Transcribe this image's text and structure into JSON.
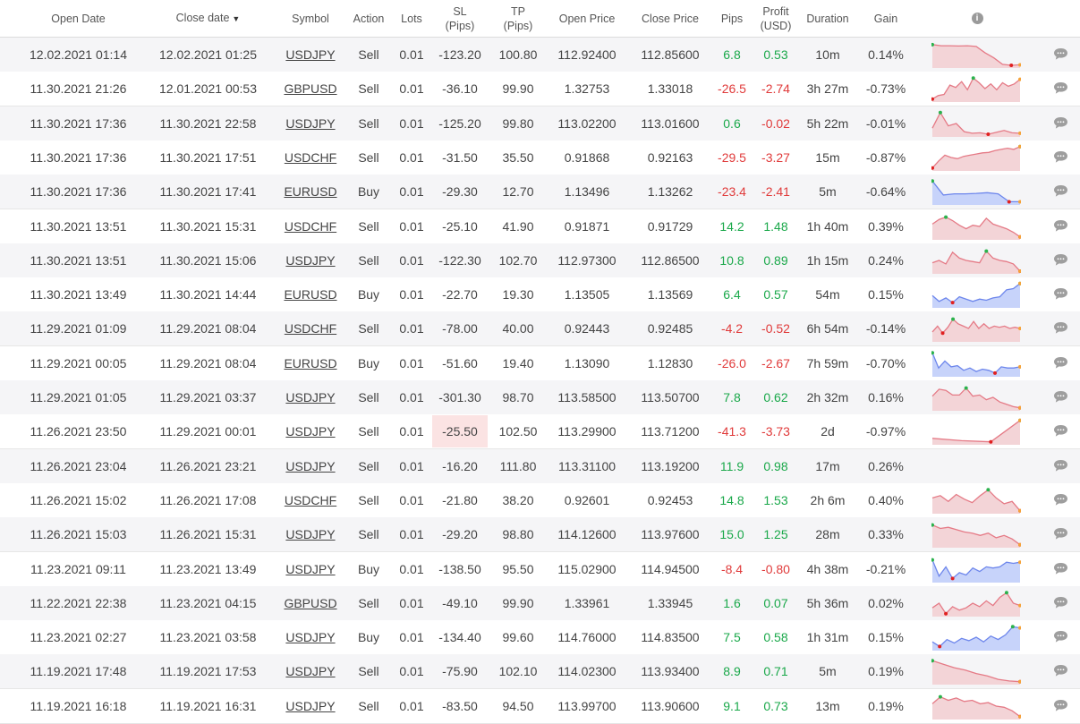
{
  "headers": {
    "open_date": "Open Date",
    "close_date": "Close date",
    "close_date_sort": "▼",
    "symbol": "Symbol",
    "action": "Action",
    "lots": "Lots",
    "sl_1": "SL",
    "sl_2": "(Pips)",
    "tp_1": "TP",
    "tp_2": "(Pips)",
    "open_price": "Open Price",
    "close_price": "Close Price",
    "pips": "Pips",
    "profit_1": "Profit",
    "profit_2": "(USD)",
    "duration": "Duration",
    "gain": "Gain",
    "info_glyph": "i"
  },
  "colors": {
    "positive": "#1aa84a",
    "negative": "#e03a3a",
    "sell_fill": "#f3d4d7",
    "sell_line": "#e57a86",
    "buy_fill": "#c7d3fa",
    "buy_line": "#6d86ec",
    "sl_highlight": "#fbe3e3",
    "comment_icon": "#9e9e9e"
  },
  "rows": [
    {
      "open": "12.02.2021 01:14",
      "close": "12.02.2021 01:25",
      "symbol": "USDJPY",
      "action": "Sell",
      "lots": "0.01",
      "sl": "-123.20",
      "tp": "100.80",
      "open_price": "112.92400",
      "close_price": "112.85600",
      "pips": "6.8",
      "profit": "0.53",
      "duration": "10m",
      "gain": "0.14%",
      "spark": [
        0.93,
        0.88,
        0.88,
        0.87,
        0.88,
        0.85,
        0.58,
        0.36,
        0.08,
        0.04,
        0.06
      ]
    },
    {
      "open": "11.30.2021 21:26",
      "close": "12.01.2021 00:53",
      "symbol": "GBPUSD",
      "action": "Sell",
      "lots": "0.01",
      "sl": "-36.10",
      "tp": "99.90",
      "open_price": "1.32753",
      "close_price": "1.33018",
      "pips": "-26.5",
      "profit": "-2.74",
      "duration": "3h 27m",
      "gain": "-0.73%",
      "spark": [
        0.05,
        0.2,
        0.25,
        0.65,
        0.55,
        0.8,
        0.45,
        0.95,
        0.75,
        0.5,
        0.7,
        0.45,
        0.75,
        0.6,
        0.7,
        0.9
      ]
    },
    {
      "open": "11.30.2021 17:36",
      "close": "11.30.2021 22:58",
      "symbol": "USDJPY",
      "action": "Sell",
      "lots": "0.01",
      "sl": "-125.20",
      "tp": "99.80",
      "open_price": "113.02200",
      "close_price": "113.01600",
      "pips": "0.6",
      "profit": "-0.02",
      "duration": "5h 22m",
      "gain": "-0.01%",
      "spark": [
        0.3,
        0.97,
        0.4,
        0.5,
        0.15,
        0.08,
        0.1,
        0.04,
        0.12,
        0.2,
        0.1,
        0.08
      ]
    },
    {
      "open": "11.30.2021 17:36",
      "close": "11.30.2021 17:51",
      "symbol": "USDCHF",
      "action": "Sell",
      "lots": "0.01",
      "sl": "-31.50",
      "tp": "35.50",
      "open_price": "0.91868",
      "close_price": "0.92163",
      "pips": "-29.5",
      "profit": "-3.27",
      "duration": "15m",
      "gain": "-0.87%",
      "spark": [
        0.05,
        0.35,
        0.6,
        0.5,
        0.45,
        0.55,
        0.6,
        0.65,
        0.7,
        0.72,
        0.8,
        0.85,
        0.9,
        0.85,
        0.97
      ]
    },
    {
      "open": "11.30.2021 17:36",
      "close": "11.30.2021 17:41",
      "symbol": "EURUSD",
      "action": "Buy",
      "lots": "0.01",
      "sl": "-29.30",
      "tp": "12.70",
      "open_price": "1.13496",
      "close_price": "1.13262",
      "pips": "-23.4",
      "profit": "-2.41",
      "duration": "5m",
      "gain": "-0.64%",
      "spark": [
        0.95,
        0.35,
        0.4,
        0.4,
        0.42,
        0.45,
        0.4,
        0.06,
        0.06
      ]
    },
    {
      "open": "11.30.2021 13:51",
      "close": "11.30.2021 15:31",
      "symbol": "USDCHF",
      "action": "Sell",
      "lots": "0.01",
      "sl": "-25.10",
      "tp": "41.90",
      "open_price": "0.91871",
      "close_price": "0.91729",
      "pips": "14.2",
      "profit": "1.48",
      "duration": "1h 40m",
      "gain": "0.39%",
      "spark": [
        0.6,
        0.8,
        0.9,
        0.75,
        0.55,
        0.4,
        0.55,
        0.5,
        0.85,
        0.6,
        0.5,
        0.4,
        0.25,
        0.05
      ]
    },
    {
      "open": "11.30.2021 13:51",
      "close": "11.30.2021 15:06",
      "symbol": "USDJPY",
      "action": "Sell",
      "lots": "0.01",
      "sl": "-122.30",
      "tp": "102.70",
      "open_price": "112.97300",
      "close_price": "112.86500",
      "pips": "10.8",
      "profit": "0.89",
      "duration": "1h 15m",
      "gain": "0.24%",
      "spark": [
        0.4,
        0.5,
        0.35,
        0.85,
        0.6,
        0.5,
        0.45,
        0.4,
        0.9,
        0.6,
        0.5,
        0.45,
        0.35,
        0.04
      ]
    },
    {
      "open": "11.30.2021 13:49",
      "close": "11.30.2021 14:44",
      "symbol": "EURUSD",
      "action": "Buy",
      "lots": "0.01",
      "sl": "-22.70",
      "tp": "19.30",
      "open_price": "1.13505",
      "close_price": "1.13569",
      "pips": "6.4",
      "profit": "0.57",
      "duration": "54m",
      "gain": "0.15%",
      "spark": [
        0.45,
        0.2,
        0.35,
        0.15,
        0.4,
        0.3,
        0.2,
        0.3,
        0.25,
        0.35,
        0.4,
        0.7,
        0.75,
        0.97
      ]
    },
    {
      "open": "11.29.2021 01:09",
      "close": "11.29.2021 08:04",
      "symbol": "USDCHF",
      "action": "Sell",
      "lots": "0.01",
      "sl": "-78.00",
      "tp": "40.00",
      "open_price": "0.92443",
      "close_price": "0.92485",
      "pips": "-4.2",
      "profit": "-0.52",
      "duration": "6h 54m",
      "gain": "-0.14%",
      "spark": [
        0.35,
        0.6,
        0.3,
        0.55,
        0.9,
        0.7,
        0.6,
        0.5,
        0.8,
        0.5,
        0.7,
        0.5,
        0.6,
        0.55,
        0.6,
        0.5,
        0.55,
        0.5
      ]
    },
    {
      "open": "11.29.2021 00:05",
      "close": "11.29.2021 08:04",
      "symbol": "EURUSD",
      "action": "Buy",
      "lots": "0.01",
      "sl": "-51.60",
      "tp": "19.40",
      "open_price": "1.13090",
      "close_price": "1.12830",
      "pips": "-26.0",
      "profit": "-2.67",
      "duration": "7h 59m",
      "gain": "-0.70%",
      "spark": [
        0.95,
        0.3,
        0.6,
        0.35,
        0.4,
        0.2,
        0.3,
        0.15,
        0.25,
        0.2,
        0.08,
        0.35,
        0.3,
        0.3,
        0.35
      ]
    },
    {
      "open": "11.29.2021 01:05",
      "close": "11.29.2021 03:37",
      "symbol": "USDJPY",
      "action": "Sell",
      "lots": "0.01",
      "sl": "-301.30",
      "tp": "98.70",
      "open_price": "113.58500",
      "close_price": "113.50700",
      "pips": "7.8",
      "profit": "0.62",
      "duration": "2h 32m",
      "gain": "0.16%",
      "spark": [
        0.55,
        0.85,
        0.8,
        0.6,
        0.6,
        0.9,
        0.55,
        0.6,
        0.4,
        0.5,
        0.3,
        0.2,
        0.1,
        0.05
      ]
    },
    {
      "open": "11.26.2021 23:50",
      "close": "11.29.2021 00:01",
      "symbol": "USDJPY",
      "action": "Sell",
      "lots": "0.01",
      "sl": "-25.50",
      "tp": "102.50",
      "open_price": "113.29900",
      "close_price": "113.71200",
      "pips": "-41.3",
      "profit": "-3.73",
      "duration": "2d",
      "gain": "-0.97%",
      "sl_highlight": true,
      "spark": [
        0.2,
        0.1,
        0.05,
        0.97
      ]
    },
    {
      "open": "11.26.2021 23:04",
      "close": "11.26.2021 23:21",
      "symbol": "USDJPY",
      "action": "Sell",
      "lots": "0.01",
      "sl": "-16.20",
      "tp": "111.80",
      "open_price": "113.31100",
      "close_price": "113.19200",
      "pips": "11.9",
      "profit": "0.98",
      "duration": "17m",
      "gain": "0.26%",
      "spark": []
    },
    {
      "open": "11.26.2021 15:02",
      "close": "11.26.2021 17:08",
      "symbol": "USDCHF",
      "action": "Sell",
      "lots": "0.01",
      "sl": "-21.80",
      "tp": "38.20",
      "open_price": "0.92601",
      "close_price": "0.92453",
      "pips": "14.8",
      "profit": "1.53",
      "duration": "2h 6m",
      "gain": "0.40%",
      "spark": [
        0.6,
        0.7,
        0.45,
        0.75,
        0.55,
        0.4,
        0.7,
        0.95,
        0.6,
        0.35,
        0.45,
        0.05
      ]
    },
    {
      "open": "11.26.2021 15:03",
      "close": "11.26.2021 15:31",
      "symbol": "USDJPY",
      "action": "Sell",
      "lots": "0.01",
      "sl": "-29.20",
      "tp": "98.80",
      "open_price": "114.12600",
      "close_price": "113.97600",
      "pips": "15.0",
      "profit": "1.25",
      "duration": "28m",
      "gain": "0.33%",
      "spark": [
        0.9,
        0.75,
        0.8,
        0.7,
        0.6,
        0.55,
        0.45,
        0.55,
        0.35,
        0.45,
        0.3,
        0.05
      ]
    },
    {
      "open": "11.23.2021 09:11",
      "close": "11.23.2021 13:49",
      "symbol": "USDJPY",
      "action": "Buy",
      "lots": "0.01",
      "sl": "-138.50",
      "tp": "95.50",
      "open_price": "115.02900",
      "close_price": "114.94500",
      "pips": "-8.4",
      "profit": "-0.80",
      "duration": "4h 38m",
      "gain": "-0.21%",
      "spark": [
        0.9,
        0.2,
        0.6,
        0.1,
        0.35,
        0.25,
        0.55,
        0.4,
        0.6,
        0.55,
        0.6,
        0.8,
        0.75,
        0.8
      ]
    },
    {
      "open": "11.22.2021 22:38",
      "close": "11.23.2021 04:15",
      "symbol": "GBPUSD",
      "action": "Sell",
      "lots": "0.01",
      "sl": "-49.10",
      "tp": "99.90",
      "open_price": "1.33961",
      "close_price": "1.33945",
      "pips": "1.6",
      "profit": "0.07",
      "duration": "5h 36m",
      "gain": "0.02%",
      "spark": [
        0.3,
        0.5,
        0.05,
        0.35,
        0.2,
        0.3,
        0.5,
        0.35,
        0.6,
        0.4,
        0.75,
        0.95,
        0.5,
        0.4
      ]
    },
    {
      "open": "11.23.2021 02:27",
      "close": "11.23.2021 03:58",
      "symbol": "USDJPY",
      "action": "Buy",
      "lots": "0.01",
      "sl": "-134.40",
      "tp": "99.60",
      "open_price": "114.76000",
      "close_price": "114.83500",
      "pips": "7.5",
      "profit": "0.58",
      "duration": "1h 31m",
      "gain": "0.15%",
      "spark": [
        0.3,
        0.1,
        0.4,
        0.25,
        0.45,
        0.35,
        0.5,
        0.3,
        0.55,
        0.4,
        0.6,
        0.95,
        0.9
      ]
    },
    {
      "open": "11.19.2021 17:48",
      "close": "11.19.2021 17:53",
      "symbol": "USDJPY",
      "action": "Sell",
      "lots": "0.01",
      "sl": "-75.90",
      "tp": "102.10",
      "open_price": "114.02300",
      "close_price": "113.93400",
      "pips": "8.9",
      "profit": "0.71",
      "duration": "5m",
      "gain": "0.19%",
      "spark": [
        0.95,
        0.8,
        0.65,
        0.55,
        0.4,
        0.3,
        0.15,
        0.08,
        0.05
      ]
    },
    {
      "open": "11.19.2021 16:18",
      "close": "11.19.2021 16:31",
      "symbol": "USDJPY",
      "action": "Sell",
      "lots": "0.01",
      "sl": "-83.50",
      "tp": "94.50",
      "open_price": "113.99700",
      "close_price": "113.90600",
      "pips": "9.1",
      "profit": "0.73",
      "duration": "13m",
      "gain": "0.19%",
      "spark": [
        0.6,
        0.9,
        0.75,
        0.85,
        0.7,
        0.75,
        0.6,
        0.65,
        0.5,
        0.45,
        0.3,
        0.05
      ]
    }
  ]
}
